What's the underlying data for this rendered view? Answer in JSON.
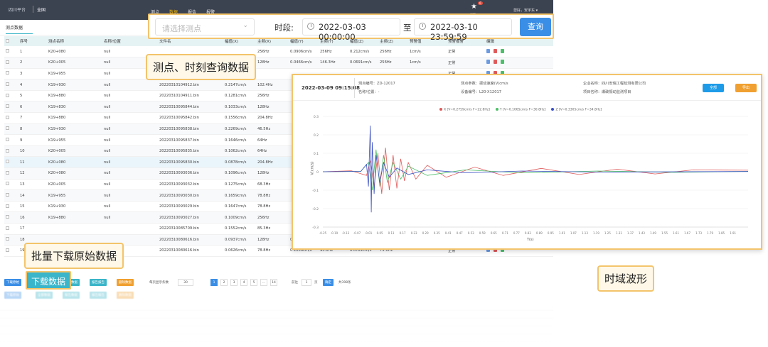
{
  "topbar": {
    "logo": "四川平台",
    "org": "全国",
    "nav": [
      "测点",
      "数据",
      "报告",
      "报警"
    ],
    "active_nav": 1,
    "alarm_count": "6",
    "alarm_label": "报警",
    "user": "您好，安宇东 ▾"
  },
  "tab": {
    "label": "测点数据"
  },
  "query": {
    "point_placeholder": "请选择测点",
    "time_label": "时段:",
    "start": "2022-03-03 00:00:00",
    "to": "至",
    "end": "2022-03-10 23:59:59",
    "btn": "查询"
  },
  "table": {
    "headers": [
      "",
      "序号",
      "测点名称",
      "名称/位置",
      "文件名",
      "幅值(X)",
      "主频(X)",
      "幅值(Y)",
      "主频(Y)",
      "幅值(Z)",
      "主频(Z)",
      "预警值",
      "预警报警",
      "编辑"
    ],
    "alarm_text": "正常",
    "rows": [
      [
        "1",
        "K20+080",
        "null",
        "",
        "",
        "256Hz",
        "0.0906cm/s",
        "256Hz",
        "0.212cm/s",
        "256Hz",
        "1cm/s"
      ],
      [
        "2",
        "K20+005",
        "null",
        "",
        "",
        "128Hz",
        "0.0466cm/s",
        "146.3Hz",
        "0.0691cm/s",
        "256Hz",
        "1cm/s"
      ],
      [
        "3",
        "K19+955",
        "null",
        "",
        "",
        "",
        "",
        "",
        "",
        "",
        ""
      ],
      [
        "4",
        "K19+930",
        "null",
        "20220310104912.bin",
        "0.2147cm/s",
        "102.4Hz",
        "",
        "",
        "",
        "",
        ""
      ],
      [
        "5",
        "K19+880",
        "null",
        "20220310104911.bin",
        "0.1281cm/s",
        "256Hz",
        "",
        "",
        "",
        "",
        ""
      ],
      [
        "6",
        "K19+830",
        "null",
        "20220310095844.bin",
        "0.1033cm/s",
        "128Hz",
        "",
        "",
        "",
        "",
        ""
      ],
      [
        "7",
        "K19+880",
        "null",
        "20220310095842.bin",
        "0.1556cm/s",
        "204.8Hz",
        "",
        "",
        "",
        "",
        ""
      ],
      [
        "8",
        "K19+930",
        "null",
        "20220310095838.bin",
        "0.2269cm/s",
        "46.5Hz",
        "",
        "",
        "",
        "",
        ""
      ],
      [
        "9",
        "K19+955",
        "null",
        "20220310095837.bin",
        "0.1646cm/s",
        "64Hz",
        "",
        "",
        "",
        "",
        ""
      ],
      [
        "10",
        "K20+005",
        "null",
        "20220310095835.bin",
        "0.1062cm/s",
        "64Hz",
        "",
        "",
        "",
        "",
        ""
      ],
      [
        "11",
        "K20+080",
        "null",
        "20220310095830.bin",
        "0.0878cm/s",
        "204.8Hz",
        "",
        "",
        "",
        "",
        ""
      ],
      [
        "12",
        "K20+080",
        "null",
        "20220310093036.bin",
        "0.1096cm/s",
        "128Hz",
        "",
        "",
        "",
        "",
        ""
      ],
      [
        "13",
        "K20+005",
        "null",
        "20220310093032.bin",
        "0.1275cm/s",
        "68.3Hz",
        "",
        "",
        "",
        "",
        ""
      ],
      [
        "14",
        "K19+955",
        "null",
        "20220310093030.bin",
        "0.1659cm/s",
        "78.8Hz",
        "",
        "",
        "",
        "",
        ""
      ],
      [
        "15",
        "K19+930",
        "null",
        "20220310093029.bin",
        "0.1647cm/s",
        "78.8Hz",
        "",
        "",
        "",
        "",
        ""
      ],
      [
        "16",
        "K19+880",
        "null",
        "20220310093027.bin",
        "0.1009cm/s",
        "256Hz",
        "",
        "",
        "",
        "",
        ""
      ],
      [
        "17",
        "",
        "",
        "20220310085709.bin",
        "0.1552cm/s",
        "85.3Hz",
        "",
        "",
        "",
        "",
        ""
      ],
      [
        "18",
        "",
        "",
        "20220310080616.bin",
        "0.0937cm/s",
        "128Hz",
        "0.0683cm/s",
        "128Hz",
        "0.1577cm/s",
        "78.8Hz",
        ""
      ],
      [
        "19",
        "",
        "",
        "20220310080616.bin",
        "0.0626cm/s",
        "78.8Hz",
        "0.1059cm/s",
        "93.1Hz",
        "0.0722cm/s",
        "73.1Hz",
        ""
      ]
    ]
  },
  "pager": {
    "btn_download": "下载原始",
    "btn_all": "全部数据",
    "btn_report1": "报告数据",
    "btn_report2": "报告报告",
    "btn_delete": "删除数据",
    "per_page_label": "每页显示条数",
    "per_page": "30",
    "pages": [
      "1",
      "2",
      "3",
      "4",
      "5",
      "...",
      "14"
    ],
    "goto_label": "前往",
    "goto_page": "1",
    "goto_unit": "页",
    "confirm": "确定",
    "total": "共398条"
  },
  "callouts": {
    "query": "测点、时刻查询数据",
    "batch": "批量下载原始数据",
    "waveform": "时域波形",
    "download_btn": "下载数据"
  },
  "panel": {
    "date": "2022-03-09 09:15:08",
    "point_no": "测点编号：ZD-12017",
    "param": "测点参数：振动速度(V)cm/s",
    "company": "企业名称：四川安瑞工程检测有限公司",
    "location": "名称/位置：-",
    "device": "设备编号：L20-X12017",
    "project": "项目名称：爆破振动监测项目",
    "btn_blue": "全部",
    "btn_orange": "导出",
    "legend": [
      {
        "label": "X [V=0.2759cm/s F=22.8Hz]",
        "color": "#e05a5a"
      },
      {
        "label": "Y [V=0.1065cm/s F=30.8Hz]",
        "color": "#4cbf68"
      },
      {
        "label": "Z [V=0.3305cm/s F=34.8Hz]",
        "color": "#3a4fc4"
      }
    ],
    "ylabel": "V(cm/s)",
    "xlabel": "T(s)"
  },
  "chart_data": {
    "type": "line",
    "xlabel": "T(s)",
    "ylabel": "V(cm/s)",
    "xlim": [
      -0.25,
      1.99
    ],
    "ylim": [
      -0.3,
      0.3
    ],
    "xticks": [
      "-0.25",
      "-0.19",
      "-0.13",
      "-0.07",
      "-0.01",
      "0.05",
      "0.11",
      "0.17",
      "0.23",
      "0.29",
      "0.35",
      "0.41",
      "0.47",
      "0.53",
      "0.59",
      "0.65",
      "0.71",
      "0.77",
      "0.83",
      "0.89",
      "0.95",
      "1.01",
      "1.07",
      "1.13",
      "1.19",
      "1.25",
      "1.31",
      "1.37",
      "1.43",
      "1.49",
      "1.55",
      "1.61",
      "1.67",
      "1.73",
      "1.79",
      "1.85",
      "1.91"
    ],
    "yticks": [
      "0.3",
      "0.2",
      "0.1",
      "0",
      "-0.1",
      "-0.2",
      "-0.3"
    ],
    "yvalues": [
      0.3,
      0.2,
      0.1,
      0,
      -0.1,
      -0.2,
      -0.3
    ],
    "series": [
      {
        "name": "X",
        "color": "#e05a5a",
        "x": [
          -0.25,
          -0.1,
          -0.02,
          0.0,
          0.02,
          0.04,
          0.06,
          0.08,
          0.1,
          0.12,
          0.14,
          0.16,
          0.18,
          0.2,
          0.24,
          0.3,
          0.4,
          0.55,
          0.7,
          0.9,
          1.1,
          1.3,
          1.5,
          1.7,
          1.99
        ],
        "y": [
          0,
          0.005,
          -0.02,
          0.06,
          -0.08,
          0.1,
          -0.12,
          0.13,
          -0.1,
          0.09,
          -0.09,
          0.07,
          -0.05,
          0.05,
          -0.04,
          0.035,
          -0.03,
          0.025,
          -0.02,
          0.018,
          -0.015,
          0.014,
          -0.012,
          0.01,
          0.008
        ]
      },
      {
        "name": "Y",
        "color": "#4cbf68",
        "x": [
          -0.25,
          -0.05,
          -0.01,
          0.01,
          0.03,
          0.05,
          0.07,
          0.09,
          0.12,
          0.16,
          0.2,
          0.3,
          0.5,
          0.8,
          1.2,
          1.6,
          1.99
        ],
        "y": [
          0,
          0.002,
          0.05,
          -0.1,
          0.12,
          -0.08,
          0.09,
          -0.06,
          0.05,
          -0.04,
          0.03,
          -0.02,
          0.01,
          -0.006,
          0.004,
          -0.003,
          0.002
        ]
      },
      {
        "name": "Z",
        "color": "#3a4fc4",
        "x": [
          -0.25,
          -0.05,
          -0.02,
          -0.01,
          0.0,
          0.005,
          0.01,
          0.02,
          0.03,
          0.05,
          0.07,
          0.1,
          0.14,
          0.2,
          0.3,
          0.5,
          0.8,
          1.2,
          1.99
        ],
        "y": [
          0,
          0.002,
          0.04,
          -0.08,
          0.25,
          -0.22,
          0.16,
          -0.12,
          0.09,
          -0.06,
          0.05,
          -0.03,
          0.02,
          -0.015,
          0.01,
          -0.006,
          0.004,
          -0.002,
          0.001
        ]
      }
    ]
  }
}
